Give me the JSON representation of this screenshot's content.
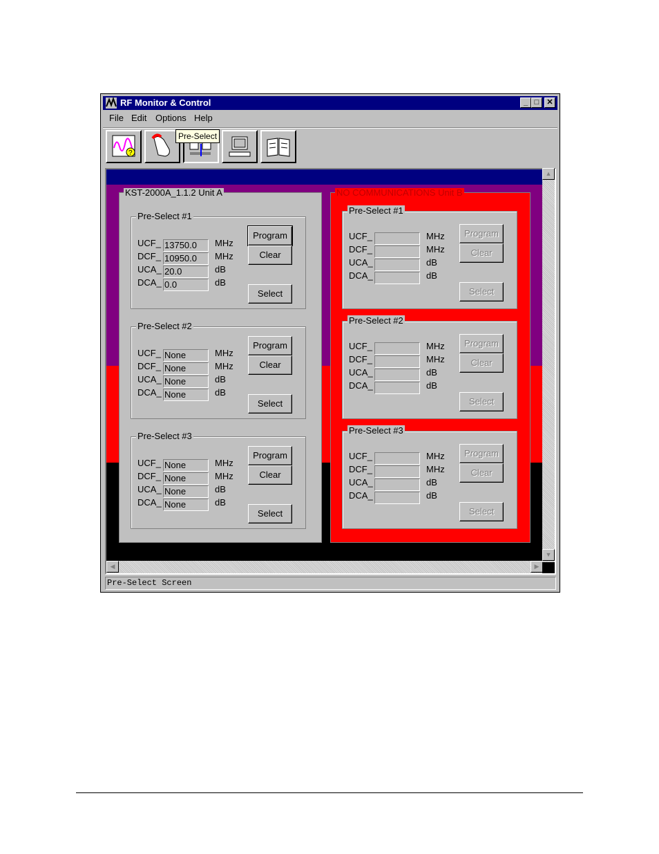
{
  "window": {
    "title": "RF Monitor & Control",
    "min": "_",
    "max": "□",
    "close": "✕"
  },
  "menu": {
    "file": "File",
    "edit": "Edit",
    "options": "Options",
    "help": "Help"
  },
  "tooltip": "Pre-Select",
  "status_text": "Pre-Select Screen",
  "colors": {
    "titlebar": "#000080",
    "unit_b_alarm": "#ff0000",
    "purple_band": "#800080",
    "red_band": "#ff0000"
  },
  "unit_a": {
    "title": "KST-2000A_1.1.2 Unit A",
    "preselects": [
      {
        "title": "Pre-Select #1",
        "ucf": "13750.0",
        "dcf": "10950.0",
        "uca": "20.0",
        "dca": "0.0",
        "program": "Program",
        "clear": "Clear",
        "select": "Select"
      },
      {
        "title": "Pre-Select #2",
        "ucf": "None",
        "dcf": "None",
        "uca": "None",
        "dca": "None",
        "program": "Program",
        "clear": "Clear",
        "select": "Select"
      },
      {
        "title": "Pre-Select #3",
        "ucf": "None",
        "dcf": "None",
        "uca": "None",
        "dca": "None",
        "program": "Program",
        "clear": "Clear",
        "select": "Select"
      }
    ]
  },
  "unit_b": {
    "title": "NO COMMUNICATIONS Unit B",
    "preselects": [
      {
        "title": "Pre-Select #1",
        "program": "Program",
        "clear": "Clear",
        "select": "Select"
      },
      {
        "title": "Pre-Select #2",
        "program": "Program",
        "clear": "Clear",
        "select": "Select"
      },
      {
        "title": "Pre-Select #3",
        "program": "Program",
        "clear": "Clear",
        "select": "Select"
      }
    ]
  },
  "labels": {
    "ucf": "UCF_",
    "dcf": "DCF_",
    "uca": "UCA_",
    "dca": "DCA_",
    "mhz": "MHz",
    "db": "dB"
  }
}
